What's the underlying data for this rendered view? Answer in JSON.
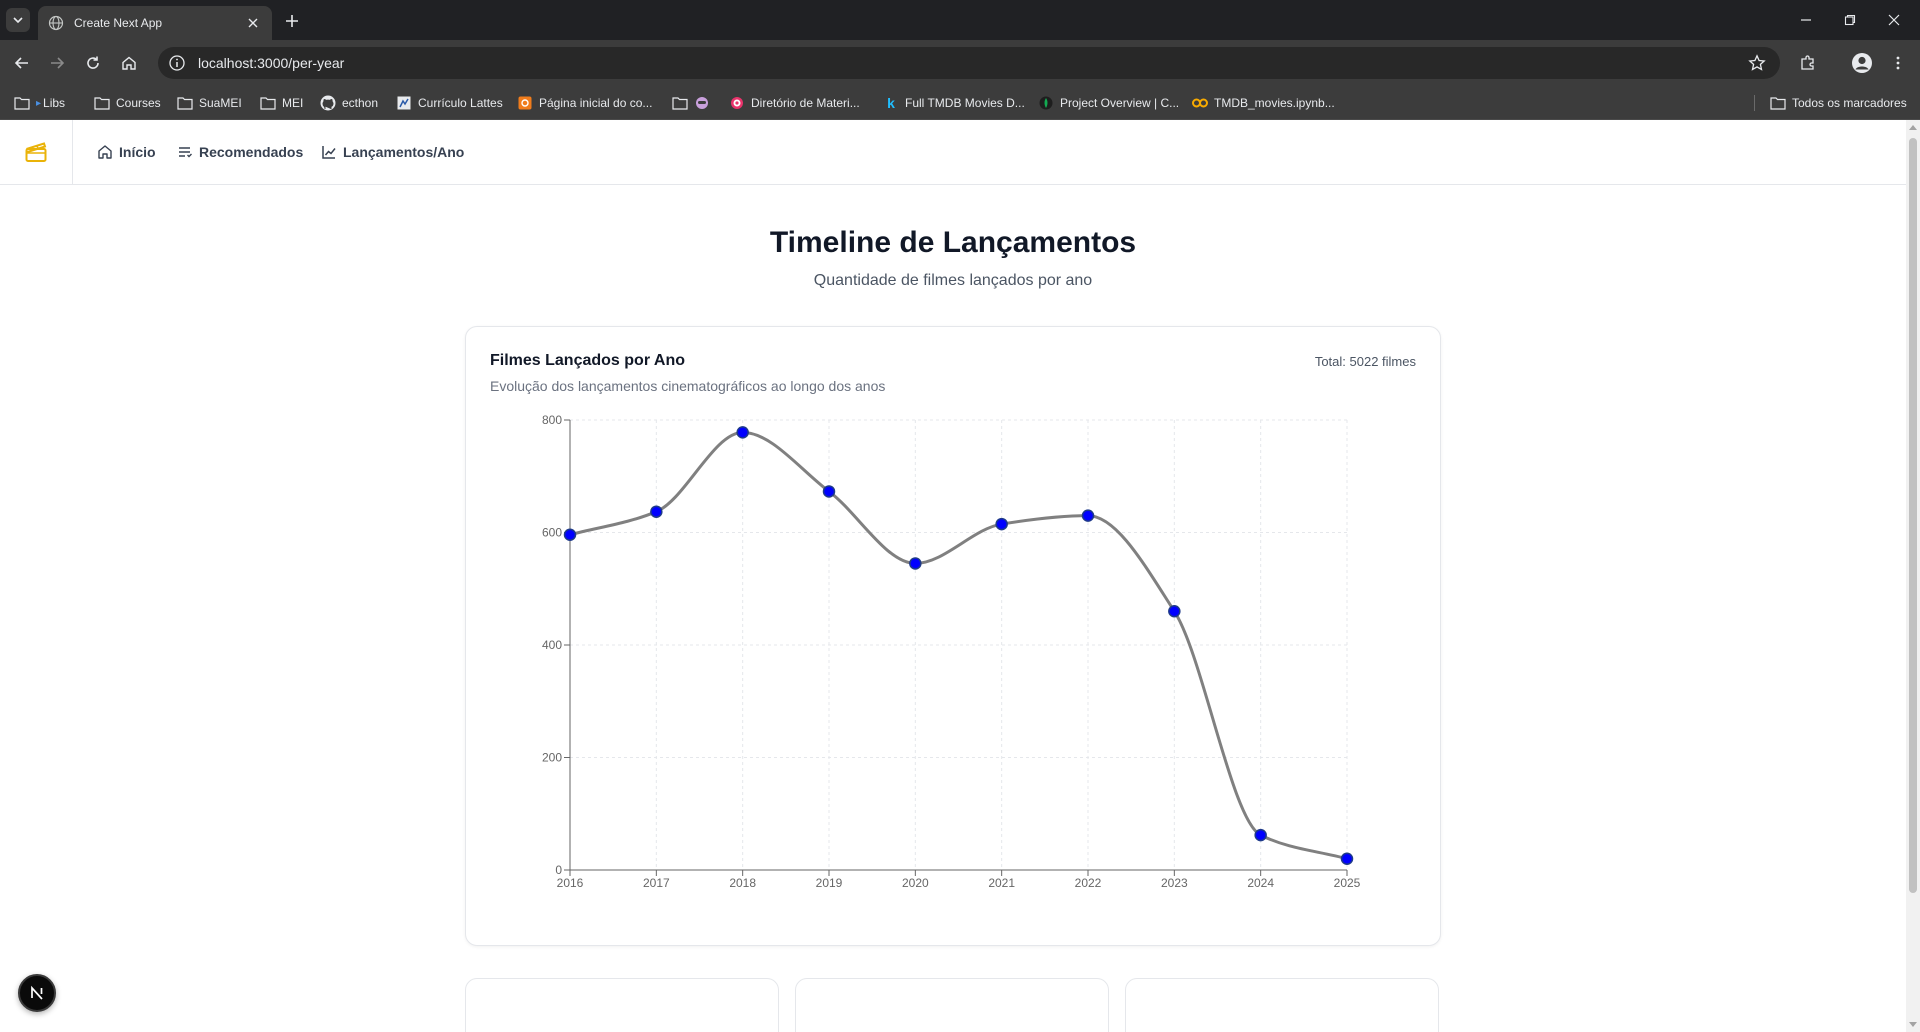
{
  "browser": {
    "tab": {
      "title": "Create Next App"
    },
    "address": {
      "url": "localhost:3000/per-year"
    },
    "bookmarks": [
      {
        "label": "Libs",
        "icon": "folder-icon"
      },
      {
        "label": "Courses",
        "icon": "folder-icon"
      },
      {
        "label": "SuaMEI",
        "icon": "folder-icon"
      },
      {
        "label": "MEI",
        "icon": "folder-icon"
      },
      {
        "label": "ecthon",
        "icon": "github-icon"
      },
      {
        "label": "Currículo Lattes",
        "icon": "lattes-icon"
      },
      {
        "label": "Página inicial do co...",
        "icon": "site-icon"
      },
      {
        "label": "",
        "icon": "folder-icon"
      },
      {
        "label": "Diretório de Materi...",
        "icon": "target-icon"
      },
      {
        "label": "Full TMDB Movies D...",
        "icon": "kaggle-icon"
      },
      {
        "label": "Project Overview | C...",
        "icon": "mongodb-icon"
      },
      {
        "label": "TMDB_movies.ipynb...",
        "icon": "colab-icon"
      }
    ],
    "all_bookmarks": "Todos os marcadores"
  },
  "app_nav": {
    "items": [
      {
        "label": "Início",
        "icon": "home-icon"
      },
      {
        "label": "Recomendados",
        "icon": "list-icon"
      },
      {
        "label": "Lançamentos/Ano",
        "icon": "chart-line-icon"
      }
    ]
  },
  "page": {
    "title": "Timeline de Lançamentos",
    "subtitle": "Quantidade de filmes lançados por ano"
  },
  "card": {
    "title": "Filmes Lançados por Ano",
    "description": "Evolução dos lançamentos cinematográficos ao longo dos anos",
    "total": "Total: 5022 filmes"
  },
  "chart_data": {
    "type": "line",
    "x": [
      "2016",
      "2017",
      "2018",
      "2019",
      "2020",
      "2021",
      "2022",
      "2023",
      "2024",
      "2025"
    ],
    "values": [
      596,
      637,
      778,
      673,
      545,
      615,
      630,
      460,
      62,
      20
    ],
    "ylim": [
      0,
      800
    ],
    "yticks": [
      0,
      200,
      400,
      600,
      800
    ],
    "grid": true,
    "line_color": "#808080",
    "point_color": "#0000ff"
  },
  "colors": {
    "accent_logo": "#eab308"
  }
}
